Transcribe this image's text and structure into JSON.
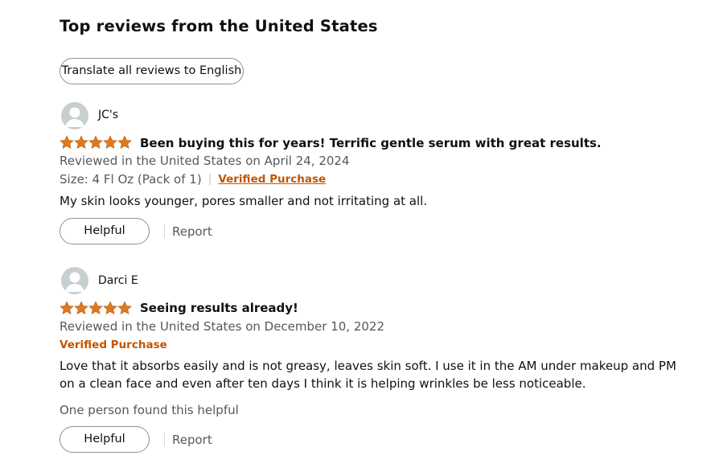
{
  "section_title": "Top reviews from the United States",
  "translate_label": "Translate all reviews to English",
  "colors": {
    "star": "#de7921",
    "verified": "#c45500",
    "avatar_bg": "#c8cfd1"
  },
  "reviews": [
    {
      "author": "JC's",
      "rating": 5,
      "headline": "Been buying this for years! Terrific gentle serum with great results.",
      "date_line": "Reviewed in the United States on April 24, 2024",
      "size": "Size: 4 Fl Oz (Pack of 1)",
      "verified": "Verified Purchase",
      "body": "My skin looks younger, pores smaller and not irritating at all.",
      "helpful_label": "Helpful",
      "report_label": "Report"
    },
    {
      "author": "Darci E",
      "rating": 5,
      "headline": "Seeing results already!",
      "date_line": "Reviewed in the United States on December 10, 2022",
      "verified": "Verified Purchase",
      "body": "Love that it absorbs easily and is not greasy, leaves skin soft. I use it in the AM under makeup and PM on a clean face and even after ten days I think it is helping wrinkles be less noticeable.",
      "helpful_count": "One person found this helpful",
      "helpful_label": "Helpful",
      "report_label": "Report"
    }
  ]
}
